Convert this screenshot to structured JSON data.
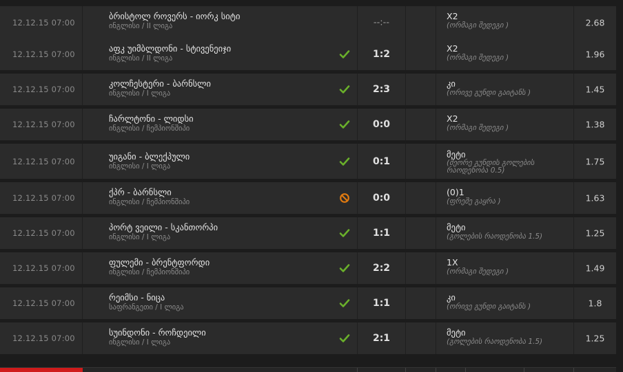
{
  "colors": {
    "win": "#6ab02b",
    "refund": "#e07a10",
    "accent": "#d01b1b"
  },
  "bets": [
    {
      "date": "12.12.15 07:00",
      "match": "ბრისტოლ როვერს - იორკ სიტი",
      "league": "ინგლისი / II ლიგა",
      "status": "none",
      "score": "--:--",
      "pick": "X2",
      "pick_desc": "(ორმაგი შედეგი )",
      "odd": "2.68"
    },
    {
      "date": "12.12.15 07:00",
      "match": "აფკ უიმბლდონი - სტივენეიჯი",
      "league": "ინგლისი / II ლიგა",
      "status": "won",
      "status_icon": "check-icon",
      "score": "1:2",
      "pick": "X2",
      "pick_desc": "(ორმაგი შედეგი )",
      "odd": "1.96"
    },
    {
      "date": "12.12.15 07:00",
      "match": "კოლჩესტერი - ბარნსლი",
      "league": "ინგლისი / I ლიგა",
      "status": "won",
      "status_icon": "check-icon",
      "score": "2:3",
      "pick": "კი",
      "pick_desc": "(ორივე გუნდი გაიტანს )",
      "odd": "1.45"
    },
    {
      "date": "12.12.15 07:00",
      "match": "ჩარლტონი - ლიდსი",
      "league": "ინგლისი / ჩემპიონშიპი",
      "status": "won",
      "status_icon": "check-icon",
      "score": "0:0",
      "pick": "X2",
      "pick_desc": "(ორმაგი შედეგი )",
      "odd": "1.38"
    },
    {
      "date": "12.12.15 07:00",
      "match": "უიგანი - ბლექპული",
      "league": "ინგლისი / I ლიგა",
      "status": "won",
      "status_icon": "check-icon",
      "score": "0:1",
      "pick": "მეტი",
      "pick_desc": "(მეორე გუნდის გოლების რაოდენობა 0.5)",
      "odd": "1.75",
      "tall": true
    },
    {
      "date": "12.12.15 07:00",
      "match": "ქპრ - ბარნსლი",
      "league": "ინგლისი / ჩემპიონშიპი",
      "status": "refund",
      "status_icon": "ban-icon",
      "score": "0:0",
      "pick": "(0)1",
      "pick_desc": "(ფრეშე გაყრა )",
      "odd": "1.63"
    },
    {
      "date": "12.12.15 07:00",
      "match": "პორტ ვეილი - სკანთორპი",
      "league": "ინგლისი / I ლიგა",
      "status": "won",
      "status_icon": "check-icon",
      "score": "1:1",
      "pick": "მეტი",
      "pick_desc": "(გოლების რაოდენობა 1.5)",
      "odd": "1.25"
    },
    {
      "date": "12.12.15 07:00",
      "match": "ფულემი - ბრენტფორდი",
      "league": "ინგლისი / ჩემპიონშიპი",
      "status": "won",
      "status_icon": "check-icon",
      "score": "2:2",
      "pick": "1X",
      "pick_desc": "(ორმაგი შედეგი )",
      "odd": "1.49"
    },
    {
      "date": "12.12.15 07:00",
      "match": "რეიმსი - ნიცა",
      "league": "საფრანგეთი / I ლიგა",
      "status": "won",
      "status_icon": "check-icon",
      "score": "1:1",
      "pick": "კი",
      "pick_desc": "(ორივე გუნდი გაიტანს )",
      "odd": "1.8"
    },
    {
      "date": "12.12.15 07:00",
      "match": "სუინდონი - როჩდეილი",
      "league": "ინგლისი / I ლიგა",
      "status": "won",
      "status_icon": "check-icon",
      "score": "2:1",
      "pick": "მეტი",
      "pick_desc": "(გოლების რაოდენობა 1.5)",
      "odd": "1.25"
    }
  ]
}
